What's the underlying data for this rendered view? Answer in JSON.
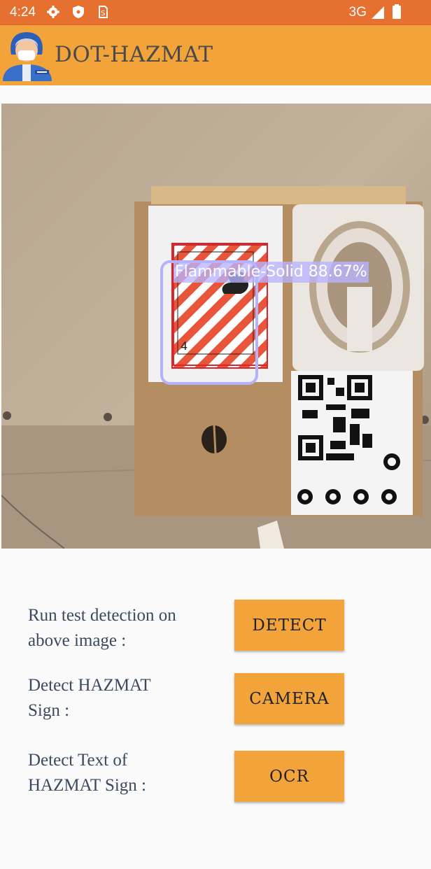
{
  "status_bar": {
    "time": "4:24",
    "network": "3G",
    "icons": [
      "settings-icon",
      "shield-icon",
      "sim-icon",
      "signal-icon",
      "battery-icon"
    ],
    "color": "#e6702f"
  },
  "app_bar": {
    "title": "DOT-HAZMAT",
    "logo_icon": "hazmat-worker-avatar-icon",
    "color": "#f2a43a"
  },
  "image_view": {
    "detection": {
      "label": "Flammable-Solid 88.67%",
      "box_color": "#b4b2ff"
    }
  },
  "controls": {
    "rows": [
      {
        "label_line1": "Run test detection on",
        "label_line2": "above image :",
        "button": "DETECT"
      },
      {
        "label_line1": "Detect HAZMAT",
        "label_line2": "Sign :",
        "button": "CAMERA"
      },
      {
        "label_line1": "Detect Text of",
        "label_line2": "HAZMAT Sign :",
        "button": "OCR"
      }
    ],
    "button_color": "#f2a43a"
  }
}
